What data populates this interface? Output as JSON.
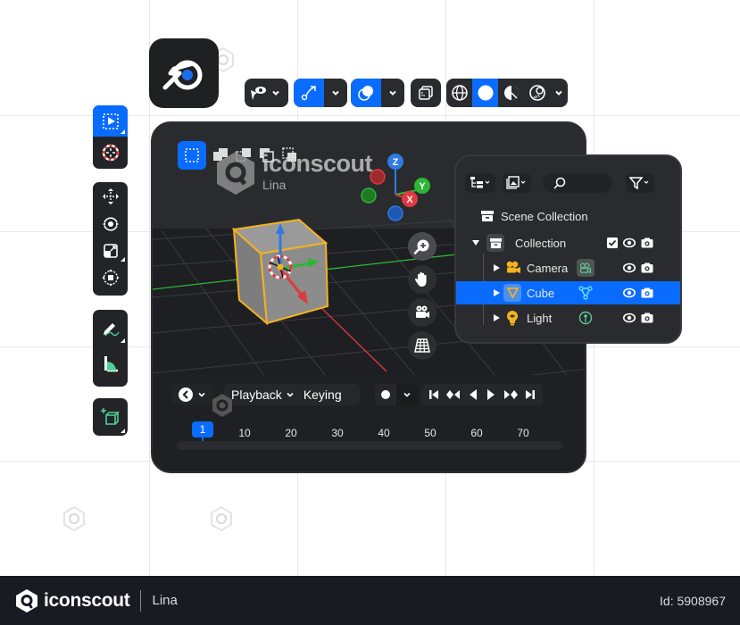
{
  "app": {
    "name": "Blender",
    "logo_icon": "blender-logo-icon"
  },
  "header_toolbar": {
    "groups": [
      {
        "name": "view-object-types",
        "icon": "eye-pointer-icon",
        "active": false,
        "has_dropdown": true
      },
      {
        "name": "gizmos",
        "icon": "gizmo-curve-arrow-icon",
        "active": true,
        "has_dropdown": true
      },
      {
        "name": "overlays",
        "icon": "overlay-circles-icon",
        "active": true,
        "has_dropdown": true
      },
      {
        "name": "xray",
        "icon": "xray-toggle-icon",
        "active": false,
        "has_dropdown": false
      },
      {
        "name": "shading",
        "modes": [
          "wireframe",
          "solid",
          "material-preview",
          "rendered"
        ],
        "active_mode": "solid",
        "has_dropdown": true
      }
    ]
  },
  "left_toolbar": {
    "groups": [
      {
        "tools": [
          {
            "name": "select-box",
            "icon": "select-box-icon",
            "active": true
          },
          {
            "name": "cursor",
            "icon": "3d-cursor-icon",
            "active": false
          }
        ]
      },
      {
        "tools": [
          {
            "name": "move",
            "icon": "move-icon"
          },
          {
            "name": "rotate",
            "icon": "rotate-icon"
          },
          {
            "name": "scale",
            "icon": "scale-icon"
          },
          {
            "name": "transform",
            "icon": "transform-icon"
          }
        ]
      },
      {
        "tools": [
          {
            "name": "annotate",
            "icon": "annotate-pencil-icon"
          },
          {
            "name": "measure",
            "icon": "measure-icon"
          }
        ]
      },
      {
        "tools": [
          {
            "name": "add-cube",
            "icon": "add-cube-icon"
          }
        ]
      }
    ]
  },
  "viewport": {
    "selection_modes": [
      "new",
      "extend",
      "subtract",
      "invert",
      "intersect"
    ],
    "active_selection_mode": "new",
    "gizmo_axes": {
      "x": "X",
      "y": "Y",
      "z": "Z"
    },
    "colors": {
      "x": "#e0393e",
      "y": "#2fb536",
      "z": "#2f7ae5",
      "selected_outline": "#f5b21f"
    },
    "nav_buttons": [
      "zoom-in",
      "pan-hand",
      "camera-view",
      "perspective-grid"
    ]
  },
  "timeline": {
    "playback_label": "Playback",
    "keying_label": "Keying",
    "frames": [
      "10",
      "20",
      "30",
      "40",
      "50",
      "60",
      "70"
    ],
    "current_frame": "1",
    "transport": [
      "jump-start",
      "prev-keyframe",
      "play-reverse",
      "play",
      "next-keyframe",
      "jump-end"
    ]
  },
  "outliner": {
    "toolbar": [
      "display-mode",
      "filter-view",
      "search",
      "filter"
    ],
    "search_placeholder": "",
    "scene_collection_label": "Scene Collection",
    "rows": [
      {
        "label": "Collection",
        "icon": "collection-icon",
        "expanded": true,
        "checkbox": true,
        "selected": false
      },
      {
        "label": "Camera",
        "icon": "camera-object-icon",
        "data_icon": "camera-data-icon",
        "selected": false
      },
      {
        "label": "Cube",
        "icon": "mesh-object-icon",
        "data_icon": "mesh-data-icon",
        "selected": true
      },
      {
        "label": "Light",
        "icon": "light-object-icon",
        "data_icon": "light-data-icon",
        "selected": false
      }
    ]
  },
  "watermark": {
    "brand": "iconscout",
    "author": "Lina"
  },
  "footer": {
    "brand": "iconscout",
    "author": "Lina",
    "id_label": "Id: 5908967"
  },
  "colors": {
    "accent": "#0a6cff",
    "panel": "#2a2b2e",
    "dark": "#1e1f22",
    "footer_bg": "#181b22"
  }
}
